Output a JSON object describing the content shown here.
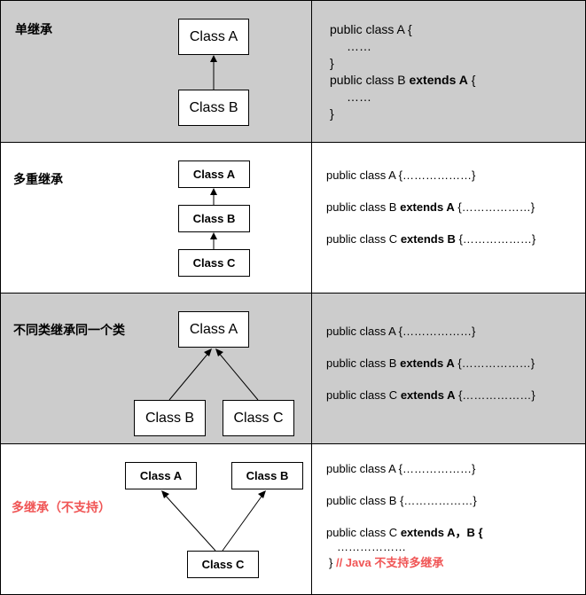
{
  "colors": {
    "shaded": "#cccccc",
    "white": "#ffffff",
    "warning": "#f05555",
    "border": "#000000"
  },
  "sections": [
    {
      "title": "单继承",
      "classes": [
        "Class A",
        "Class B"
      ],
      "code": {
        "l1": "public class A {",
        "l2": "……",
        "l3": "}",
        "l4_pre": "public class B ",
        "l4_kw": "extends A",
        "l4_post": " {",
        "l5": "……",
        "l6": "}"
      }
    },
    {
      "title": "多重继承",
      "classes": [
        "Class A",
        "Class B",
        "Class C"
      ],
      "code": {
        "l1": "public class A {………………}",
        "l2_pre": "public class B ",
        "l2_kw": "extends A",
        "l2_post": " {………………}",
        "l3_pre": "public class C ",
        "l3_kw": "extends B",
        "l3_post": " {………………}"
      }
    },
    {
      "title": "不同类继承同一个类",
      "classes": [
        "Class A",
        "Class B",
        "Class C"
      ],
      "code": {
        "l1": "public class A {………………}",
        "l2_pre": "public class B ",
        "l2_kw": "extends A",
        "l2_post": " {………………}",
        "l3_pre": "public class C ",
        "l3_kw": "extends A",
        "l3_post": " {………………}"
      }
    },
    {
      "title": "多继承（不支持）",
      "classes": [
        "Class A",
        "Class B",
        "Class C"
      ],
      "code": {
        "l1": "public class A {………………}",
        "l2": "public class B {………………}",
        "l3_pre": "public class C ",
        "l3_kw": "extends A，B {",
        "l4": "………………",
        "l5_brace": "}",
        "l5_comment": "// Java 不支持多继承"
      }
    }
  ]
}
